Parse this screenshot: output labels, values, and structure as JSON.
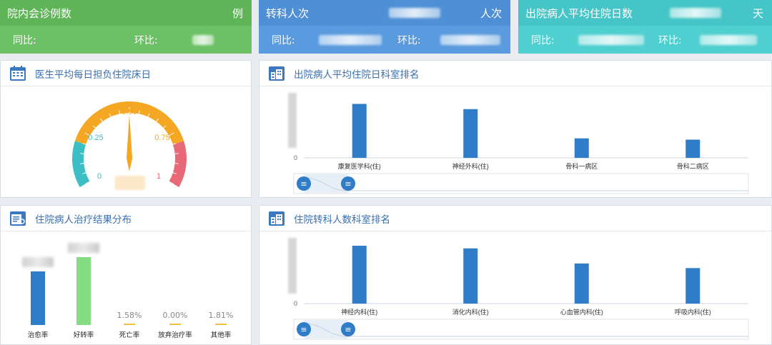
{
  "kpis": [
    {
      "title": "院内会诊例数",
      "unit": "例",
      "yoy_label": "同比:",
      "mom_label": "环比:",
      "color": "#6cc065",
      "color_dark": "#5eb457"
    },
    {
      "title": "转科人次",
      "unit": "人次",
      "yoy_label": "同比:",
      "mom_label": "环比:",
      "color": "#5a9ade",
      "color_dark": "#4f8fd6"
    },
    {
      "title": "出院病人平均住院日数",
      "unit": "天",
      "yoy_label": "同比:",
      "mom_label": "环比:",
      "color": "#4fcfd0",
      "color_dark": "#45c5c7"
    }
  ],
  "panels": {
    "gauge": {
      "title": "医生平均每日担负住院床日",
      "icon": "calendar-icon",
      "ticks": [
        "0",
        "0.25",
        "0.50",
        "0.75",
        "1"
      ],
      "value": 0.5
    },
    "treatment": {
      "title": "住院病人治疗结果分布",
      "icon": "report-icon",
      "categories": [
        "治愈率",
        "好转率",
        "死亡率",
        "放弃治疗率",
        "其他率"
      ],
      "pct_labels": [
        "",
        "",
        "1.58%",
        "0.00%",
        "1.81%"
      ],
      "colors": [
        "#2f7cc9",
        "#86dc84",
        "#f0c040",
        "#f0c040",
        "#f0c040"
      ]
    },
    "ranking1": {
      "title": "出院病人平均住院日科室排名",
      "icon": "building-icon",
      "y_min_label": "0"
    },
    "ranking2": {
      "title": "住院转科人数科室排名",
      "icon": "building-icon",
      "y_min_label": "0"
    }
  },
  "chart_data": [
    {
      "type": "bar",
      "title": "出院病人平均住院日科室排名",
      "categories": [
        "康复医学科(住)",
        "神经外科(住)",
        "骨科一病区",
        "骨科二病区"
      ],
      "values": [
        83,
        75,
        30,
        28
      ],
      "ylim": [
        0,
        100
      ],
      "bar_color": "#2f7cc9"
    },
    {
      "type": "bar",
      "title": "住院转科人数科室排名",
      "categories": [
        "神经内科(住)",
        "消化内科(住)",
        "心血管内科(住)",
        "呼吸内科(住)"
      ],
      "values": [
        88,
        84,
        61,
        54
      ],
      "ylim": [
        0,
        100
      ],
      "bar_color": "#2f7cc9"
    },
    {
      "type": "bar",
      "title": "住院病人治疗结果分布",
      "categories": [
        "治愈率",
        "好转率",
        "死亡率",
        "放弃治疗率",
        "其他率"
      ],
      "values": [
        75,
        95,
        1.58,
        0.0,
        1.81
      ],
      "ylim": [
        0,
        100
      ]
    }
  ]
}
